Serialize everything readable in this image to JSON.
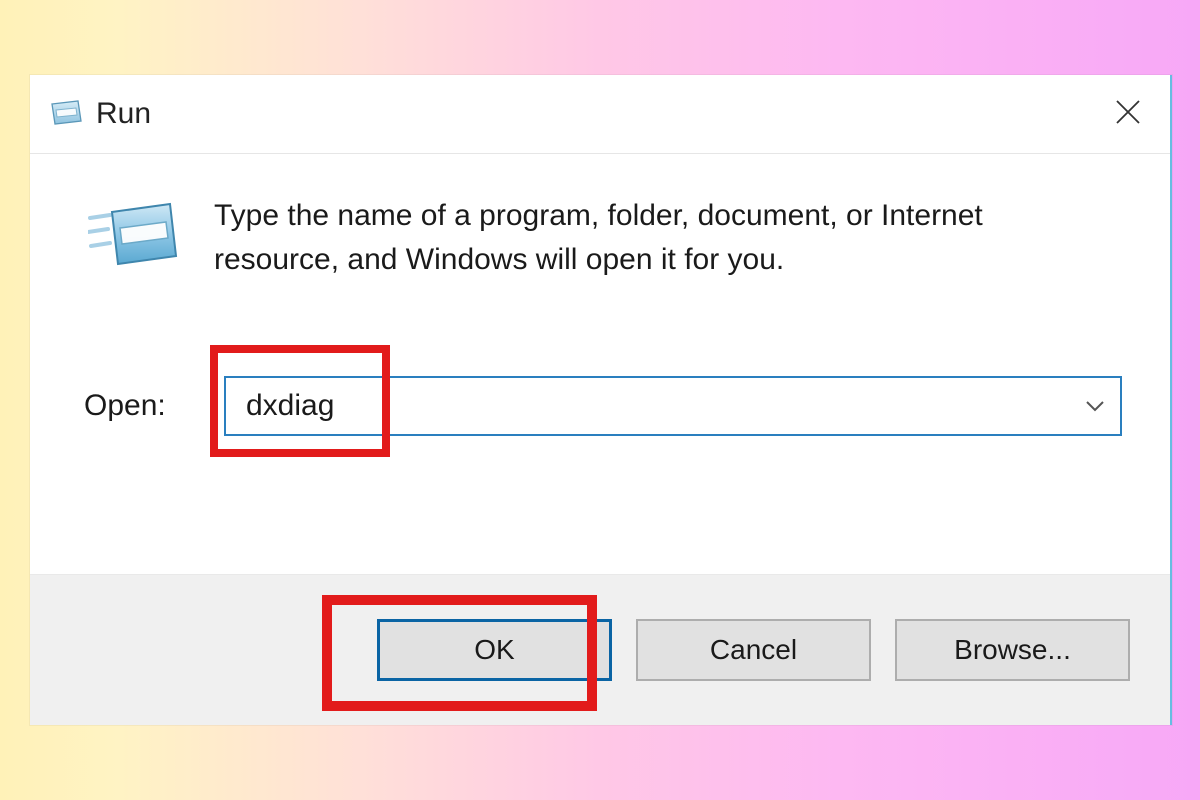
{
  "dialog": {
    "title": "Run",
    "description": "Type the name of a program, folder, document, or Internet resource, and Windows will open it for you.",
    "open_label": "Open:",
    "input_value": "dxdiag",
    "buttons": {
      "ok": "OK",
      "cancel": "Cancel",
      "browse": "Browse..."
    }
  }
}
